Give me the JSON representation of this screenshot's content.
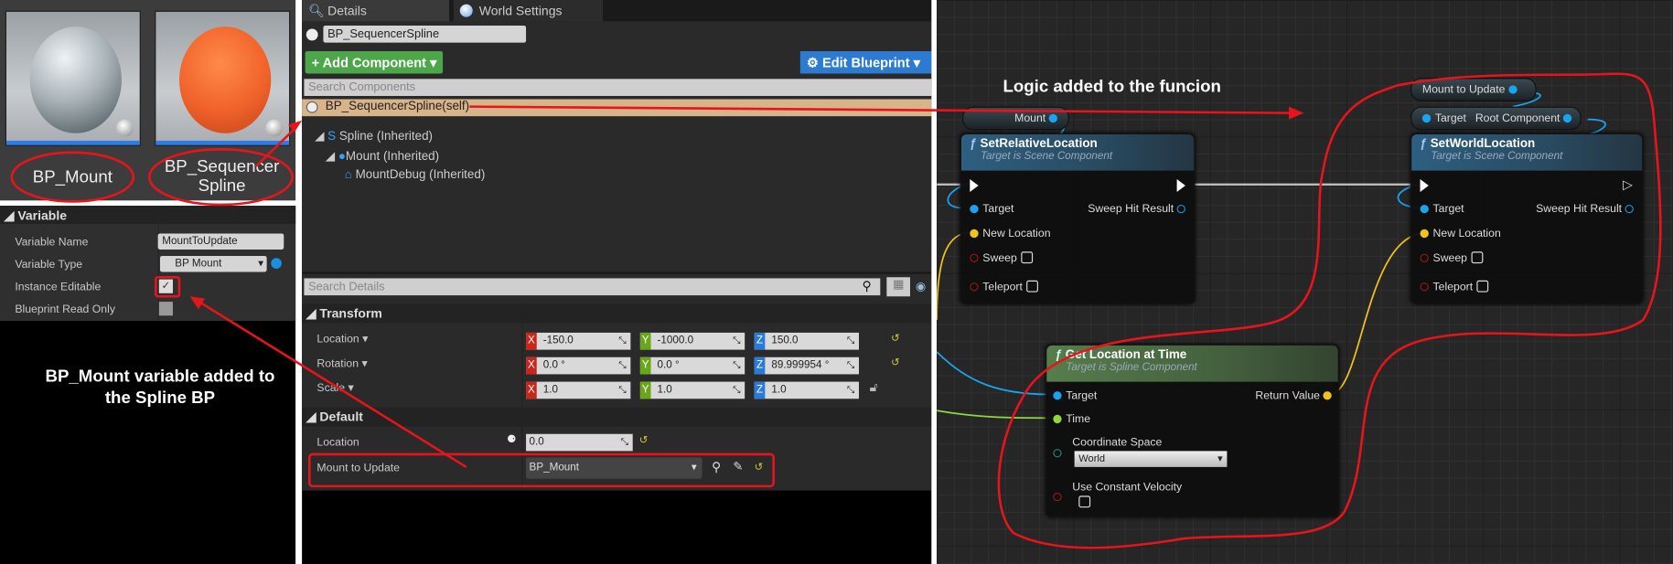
{
  "assets": [
    {
      "label": "BP_Mount",
      "color": "#b8c0c4"
    },
    {
      "label": "BP_Sequencer Spline",
      "line1": "BP_Sequencer",
      "line2": "Spline",
      "color": "#f26a2a"
    }
  ],
  "variable_panel": {
    "header": "Variable",
    "rows": [
      {
        "label": "Variable Name",
        "value": "MountToUpdate"
      },
      {
        "label": "Variable Type",
        "value": "BP Mount"
      },
      {
        "label": "Instance Editable",
        "checked": true
      },
      {
        "label": "Blueprint Read Only",
        "checked": false
      }
    ]
  },
  "annotations": {
    "left": "BP_Mount variable added to the Spline BP",
    "graph": "Logic added to the funcion"
  },
  "details": {
    "tabs": [
      {
        "label": "Details"
      },
      {
        "label": "World Settings"
      }
    ],
    "actor_name": "BP_SequencerSpline",
    "add_component": "+ Add Component",
    "edit_blueprint": "Edit Blueprint",
    "search_components_placeholder": "Search Components",
    "self_row": "BP_SequencerSpline(self)",
    "tree": [
      "Spline (Inherited)",
      "Mount (Inherited)",
      "MountDebug (Inherited)"
    ],
    "search_details_placeholder": "Search Details",
    "transform": {
      "header": "Transform",
      "rows": [
        {
          "label": "Location",
          "x": "-150.0",
          "y": "-1000.0",
          "z": "150.0"
        },
        {
          "label": "Rotation",
          "x": "0.0 °",
          "y": "0.0 °",
          "z": "89.999954 °"
        },
        {
          "label": "Scale",
          "x": "1.0",
          "y": "1.0",
          "z": "1.0"
        }
      ]
    },
    "default": {
      "header": "Default",
      "location_label": "Location",
      "location_value": "0.0",
      "mount_label": "Mount to Update",
      "mount_value": "BP_Mount"
    }
  },
  "graph": {
    "mount_var": "Mount",
    "mount_to_update_var": "Mount to Update",
    "root_component": {
      "target": "Target",
      "output": "Root Component"
    },
    "set_relative": {
      "title": "SetRelativeLocation",
      "subtitle": "Target is Scene Component",
      "pins": {
        "target": "Target",
        "new_location": "New Location",
        "sweep": "Sweep",
        "teleport": "Teleport",
        "sweep_hit": "Sweep Hit Result"
      }
    },
    "set_world": {
      "title": "SetWorldLocation",
      "subtitle": "Target is Scene Component",
      "pins": {
        "target": "Target",
        "new_location": "New Location",
        "sweep": "Sweep",
        "teleport": "Teleport",
        "sweep_hit": "Sweep Hit Result"
      }
    },
    "get_location": {
      "title": "Get Location at Time",
      "subtitle": "Target is Spline Component",
      "pins": {
        "target": "Target",
        "time": "Time",
        "coord_space": "Coordinate Space",
        "coord_value": "World",
        "constant_velocity": "Use Constant Velocity",
        "return_value": "Return Value"
      }
    }
  },
  "colors": {
    "annotation": "#e8141c",
    "object_pin": "#1aa3ee",
    "vector_pin": "#f0c21e",
    "float_pin": "#8fd640",
    "bool_pin": "#b01818"
  }
}
